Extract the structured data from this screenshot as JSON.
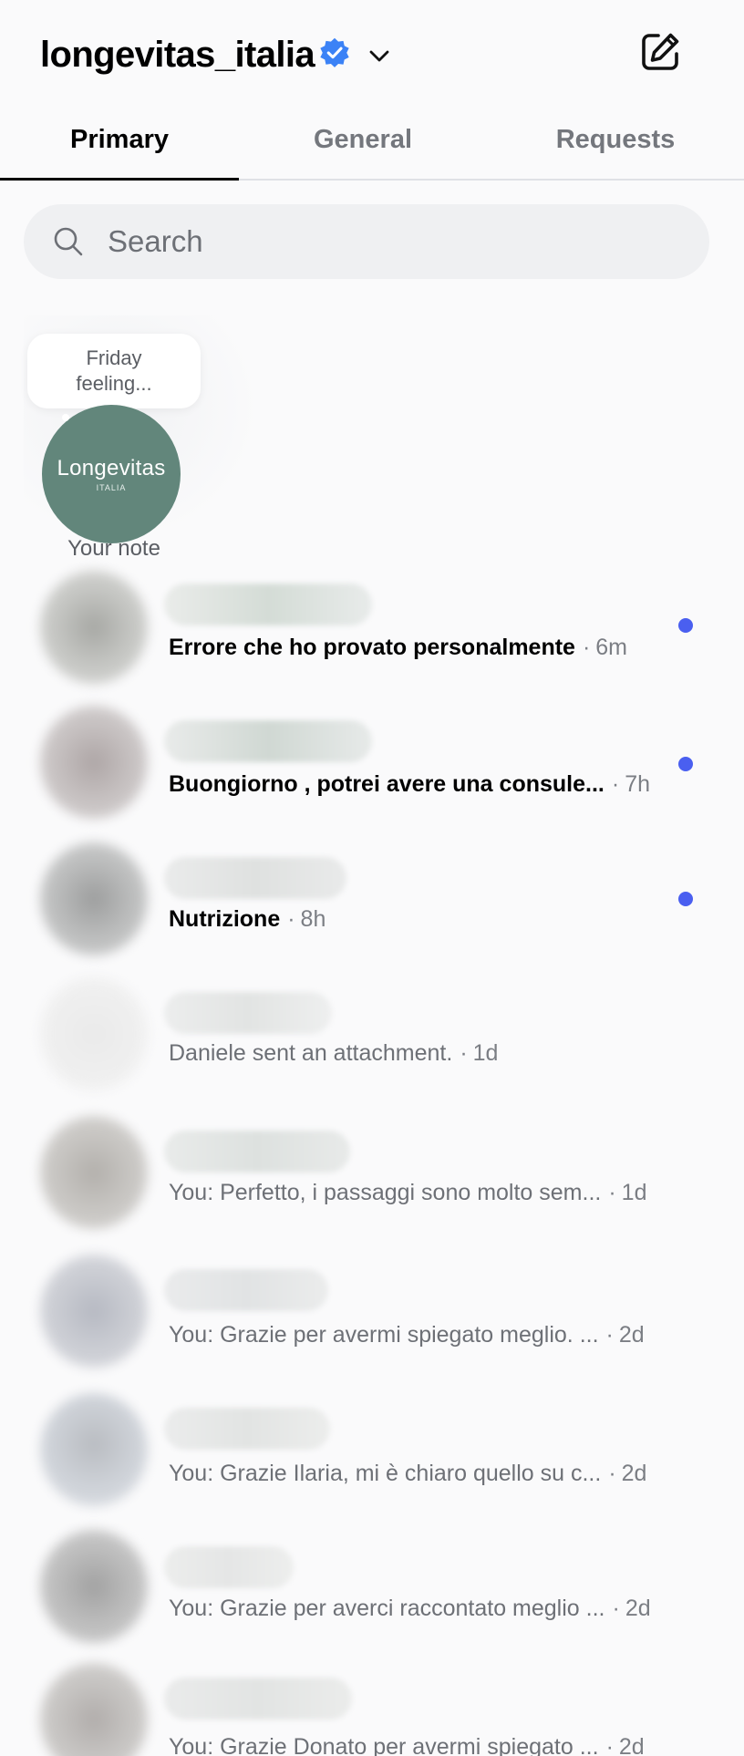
{
  "header": {
    "account_name": "longevitas_italia",
    "verified_color": "#3b82f6"
  },
  "tabs": [
    {
      "label": "Primary",
      "active": true
    },
    {
      "label": "General",
      "active": false
    },
    {
      "label": "Requests",
      "active": false
    }
  ],
  "search": {
    "placeholder": "Search"
  },
  "note": {
    "text_line1": "Friday",
    "text_line2": "feeling...",
    "avatar_brand": "Longevitas",
    "avatar_brand_sub": "ITALIA",
    "label": "Your note",
    "avatar_color": "#62867b"
  },
  "threads": [
    {
      "preview": "Errore che ho provato personalmente",
      "time": "6m",
      "unread": true
    },
    {
      "preview": "Buongiorno , potrei avere una consule...",
      "time": "7h",
      "unread": true
    },
    {
      "preview": "Nutrizione",
      "time": "8h",
      "unread": true
    },
    {
      "preview": "Daniele sent an attachment.",
      "time": "1d",
      "unread": false
    },
    {
      "preview": "You: Perfetto, i passaggi sono molto sem...",
      "time": "1d",
      "unread": false
    },
    {
      "preview": "You: Grazie per avermi spiegato meglio. ...",
      "time": "2d",
      "unread": false
    },
    {
      "preview": "You: Grazie Ilaria, mi è chiaro quello su c...",
      "time": "2d",
      "unread": false
    },
    {
      "preview": "You: Grazie per averci raccontato meglio ...",
      "time": "2d",
      "unread": false
    },
    {
      "preview": "You: Grazie Donato per avermi spiegato ...",
      "time": "2d",
      "unread": false
    }
  ],
  "colors": {
    "unread_dot": "#4a5ff0",
    "background": "#fafafb"
  }
}
